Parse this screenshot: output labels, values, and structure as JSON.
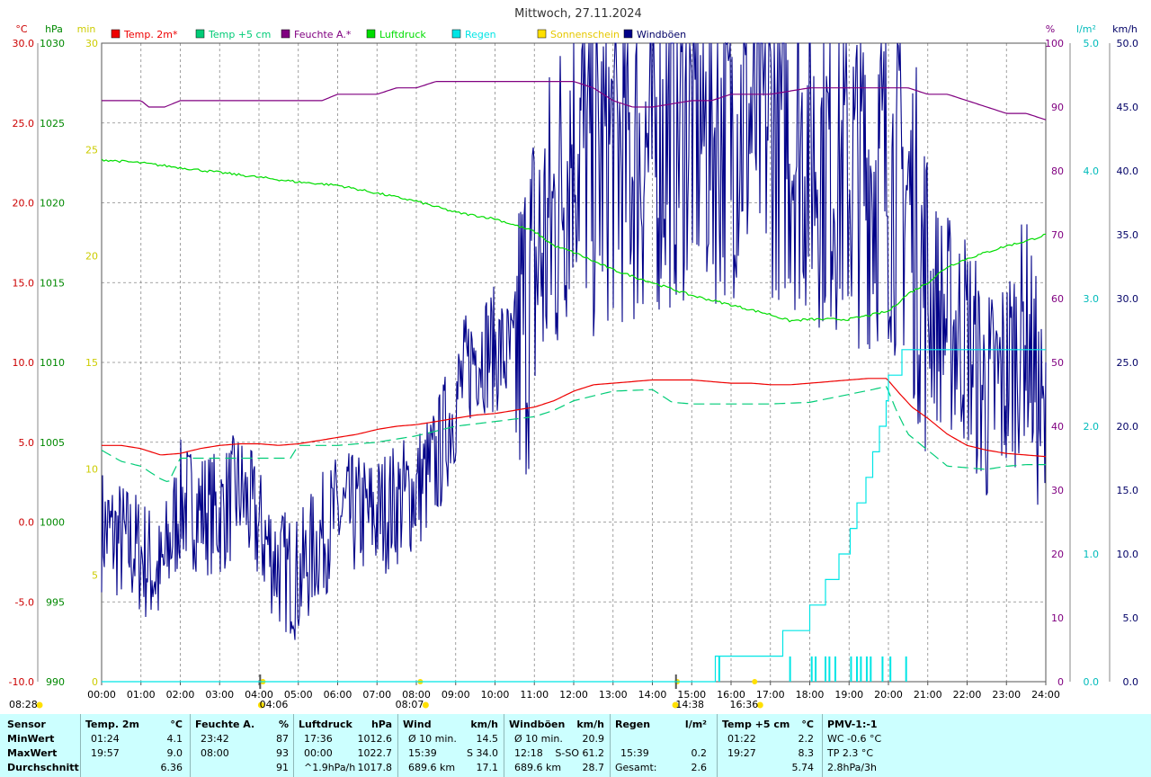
{
  "title": "Mittwoch, 27.11.2024",
  "colors": {
    "temp2m": "#ee0000",
    "temp5cm": "#00cc77",
    "humidity": "#800080",
    "pressure": "#00dd00",
    "rain": "#00e5e5",
    "sun": "#ffe000",
    "wind": "#000088",
    "grid": "#888888",
    "axis_c": "#cc0000",
    "axis_hpa": "#008800",
    "axis_min": "#cccc00",
    "axis_pct": "#800080",
    "axis_rain": "#00bbbb",
    "axis_kmh": "#000066",
    "stats_bg": "#ccffff"
  },
  "legend": [
    {
      "label": "Temp. 2m*",
      "color": "#ee0000"
    },
    {
      "label": "Temp +5 cm",
      "color": "#00cc77"
    },
    {
      "label": "Feuchte A.*",
      "color": "#800080"
    },
    {
      "label": "Luftdruck",
      "color": "#00dd00"
    },
    {
      "label": "Regen",
      "color": "#00e5e5"
    },
    {
      "label": "Sonnenschein",
      "color": "#ffe000"
    },
    {
      "label": "Windböen",
      "color": "#000088"
    }
  ],
  "chart_data": {
    "type": "line",
    "title": "Mittwoch, 27.11.2024",
    "x_unit": "hours",
    "xlim": [
      0,
      24
    ],
    "grid": true,
    "legend_position": "top",
    "x_ticks": [
      "00:00",
      "01:00",
      "02:00",
      "03:00",
      "04:00",
      "05:00",
      "06:00",
      "07:00",
      "08:00",
      "09:00",
      "10:00",
      "11:00",
      "12:00",
      "13:00",
      "14:00",
      "15:00",
      "16:00",
      "17:00",
      "18:00",
      "19:00",
      "20:00",
      "21:00",
      "22:00",
      "23:00",
      "24:00"
    ],
    "x_markers": [
      "04:06",
      "08:07",
      "14:38",
      "16:36"
    ],
    "axes": {
      "celsius": {
        "unit": "°C",
        "range": [
          -10,
          30
        ],
        "ticks": [
          "30.0",
          "25.0",
          "20.0",
          "15.0",
          "10.0",
          "5.0",
          "0.0",
          "-5.0",
          "-10.0"
        ]
      },
      "hpa": {
        "unit": "hPa",
        "range": [
          990,
          1030
        ],
        "ticks": [
          "1030",
          "1025",
          "1020",
          "1015",
          "1010",
          "1005",
          "1000",
          "995",
          "990"
        ]
      },
      "minutes": {
        "unit": "min",
        "range": [
          0,
          30
        ],
        "ticks": [
          "30",
          "25",
          "20",
          "15",
          "10",
          "5",
          "0"
        ]
      },
      "percent": {
        "unit": "%",
        "range": [
          0,
          100
        ],
        "ticks": [
          "100",
          "90",
          "80",
          "70",
          "60",
          "50",
          "40",
          "30",
          "20",
          "10",
          "0"
        ]
      },
      "rain": {
        "unit": "l/m²",
        "range": [
          0,
          5
        ],
        "ticks": [
          "5.0",
          "4.0",
          "3.0",
          "2.0",
          "1.0",
          "0.0"
        ]
      },
      "kmh": {
        "unit": "km/h",
        "range": [
          0,
          50
        ],
        "ticks": [
          "50.0",
          "45.0",
          "40.0",
          "35.0",
          "30.0",
          "25.0",
          "20.0",
          "15.0",
          "10.0",
          "5.0",
          "0.0"
        ]
      }
    },
    "series": [
      {
        "name": "Temp. 2m*",
        "axis": "celsius",
        "x": [
          0,
          0.5,
          1,
          1.5,
          2,
          2.5,
          3,
          3.5,
          4,
          4.5,
          5,
          5.5,
          6,
          6.5,
          7,
          7.5,
          8,
          8.5,
          9,
          9.5,
          10,
          10.5,
          11,
          11.5,
          12,
          12.5,
          13,
          13.5,
          14,
          14.5,
          15,
          15.5,
          16,
          16.5,
          17,
          17.5,
          18,
          18.5,
          19,
          19.5,
          19.95,
          20.3,
          20.6,
          21,
          21.5,
          22,
          22.5,
          23,
          23.5,
          24
        ],
        "y": [
          4.8,
          4.8,
          4.6,
          4.2,
          4.3,
          4.6,
          4.8,
          4.9,
          4.9,
          4.8,
          4.9,
          5.1,
          5.3,
          5.5,
          5.8,
          6.0,
          6.1,
          6.3,
          6.5,
          6.7,
          6.8,
          7.0,
          7.2,
          7.6,
          8.2,
          8.6,
          8.7,
          8.8,
          8.9,
          8.9,
          8.9,
          8.8,
          8.7,
          8.7,
          8.6,
          8.6,
          8.7,
          8.8,
          8.9,
          9.0,
          9.0,
          8.0,
          7.2,
          6.5,
          5.5,
          4.8,
          4.5,
          4.3,
          4.2,
          4.1
        ]
      },
      {
        "name": "Temp +5 cm",
        "axis": "celsius",
        "dashed": true,
        "x": [
          0,
          0.5,
          1,
          1.5,
          1.7,
          2,
          3,
          4,
          4.8,
          5,
          6,
          7,
          8,
          9,
          10,
          11,
          11.5,
          12,
          13,
          14,
          14.5,
          15,
          16,
          17,
          18,
          19,
          19.6,
          19.95,
          20.2,
          20.5,
          21,
          21.5,
          22,
          22.5,
          23,
          23.5,
          24
        ],
        "y": [
          4.5,
          3.8,
          3.5,
          2.7,
          2.5,
          4.0,
          4.0,
          4.0,
          4.0,
          4.8,
          4.8,
          5.0,
          5.4,
          6.0,
          6.3,
          6.6,
          7.0,
          7.6,
          8.2,
          8.3,
          7.5,
          7.4,
          7.4,
          7.4,
          7.5,
          8.0,
          8.3,
          8.5,
          7.0,
          5.5,
          4.5,
          3.5,
          3.4,
          3.3,
          3.5,
          3.6,
          3.6
        ]
      },
      {
        "name": "Feuchte A.*",
        "axis": "percent",
        "x": [
          0,
          1,
          1.2,
          1.6,
          2,
          3,
          4,
          4.5,
          5,
          5.2,
          5.6,
          6,
          7,
          7.5,
          8,
          8.5,
          9,
          10,
          11,
          11.5,
          12,
          12.5,
          13,
          13.5,
          14,
          15,
          15.5,
          16,
          17,
          18,
          19,
          19.5,
          20,
          20.5,
          21,
          21.5,
          22,
          22.5,
          23,
          23.5,
          24
        ],
        "y": [
          91,
          91,
          90,
          90,
          91,
          91,
          91,
          91,
          91,
          91,
          91,
          92,
          92,
          93,
          93,
          94,
          94,
          94,
          94,
          94,
          94,
          93,
          91,
          90,
          90,
          91,
          91,
          92,
          92,
          93,
          93,
          93,
          93,
          93,
          92,
          92,
          91,
          90,
          89,
          89,
          88
        ]
      },
      {
        "name": "Luftdruck",
        "axis": "hpa",
        "x": [
          0,
          1,
          2,
          3,
          4,
          5,
          6,
          7,
          8,
          9,
          10,
          11,
          11.5,
          12,
          13,
          14,
          15,
          16,
          17,
          17.5,
          18,
          19,
          20,
          20.5,
          21,
          21.5,
          22,
          22.5,
          23,
          23.5,
          24
        ],
        "y": [
          1022.7,
          1022.5,
          1022.2,
          1021.9,
          1021.6,
          1021.3,
          1021.1,
          1020.6,
          1020.1,
          1019.4,
          1019.0,
          1018.2,
          1017.3,
          1016.9,
          1015.8,
          1015.0,
          1014.2,
          1013.6,
          1013.0,
          1012.6,
          1012.7,
          1012.7,
          1013.2,
          1014.3,
          1015.0,
          1016.0,
          1016.5,
          1016.9,
          1017.3,
          1017.6,
          1018.0
        ]
      },
      {
        "name": "Regen",
        "axis": "rain",
        "step": true,
        "x": [
          0,
          15.5,
          15.6,
          16.7,
          17.1,
          17.3,
          18.0,
          18.4,
          18.7,
          19.0,
          19.2,
          19.4,
          19.6,
          19.75,
          19.9,
          20.0,
          20.3,
          20.5,
          24
        ],
        "y": [
          0,
          0,
          0.2,
          0.2,
          0.2,
          0.4,
          0.6,
          0.8,
          1.0,
          1.2,
          1.4,
          1.6,
          1.8,
          2.0,
          2.2,
          2.4,
          2.6,
          2.6,
          2.6
        ]
      },
      {
        "name": "Windböen",
        "axis": "kmh",
        "noisy": true,
        "x": [
          0,
          1,
          1.5,
          2,
          3,
          3.5,
          4,
          4.5,
          5,
          5.5,
          6,
          7,
          7.5,
          8,
          8.5,
          9,
          9.5,
          10,
          10.5,
          11,
          11.5,
          12,
          12.5,
          13,
          13.5,
          14,
          14.5,
          15,
          15.5,
          16,
          16.5,
          17,
          17.5,
          18,
          18.5,
          19,
          19.5,
          20,
          20.5,
          21,
          21.5,
          22,
          22.5,
          23,
          23.5,
          24
        ],
        "y": [
          12,
          10,
          8,
          14,
          13,
          15,
          12,
          9,
          8,
          11,
          13,
          13,
          14,
          15,
          17,
          22,
          26,
          26,
          25,
          32,
          36,
          44,
          40,
          42,
          41,
          42,
          43,
          44,
          43,
          44,
          44,
          44,
          43,
          42,
          41,
          40,
          40,
          40,
          38,
          30,
          28,
          27,
          22,
          24,
          28,
          18
        ]
      }
    ],
    "rain_events_x": [
      15.7,
      17.5,
      18.05,
      18.15,
      18.4,
      18.5,
      18.65,
      19.05,
      19.2,
      19.3,
      19.45,
      19.55,
      19.85,
      20.05,
      20.45
    ],
    "sun_markers_x": [
      4.1,
      8.1,
      14.63,
      16.6
    ]
  },
  "stats": {
    "rows": [
      "MinWert",
      "MaxWert",
      "Durchschnitt"
    ],
    "sensor_label": "Sensor",
    "cols": [
      {
        "header": "Temp. 2m",
        "unit": "°C",
        "min_time": "01:24",
        "min_val": "4.1",
        "max_time": "19:57",
        "max_val": "9.0",
        "avg_time": "",
        "avg_val": "6.36"
      },
      {
        "header": "Feuchte A.",
        "unit": "%",
        "min_time": "23:42",
        "min_val": "87",
        "max_time": "08:00",
        "max_val": "93",
        "avg_time": "",
        "avg_val": "91"
      },
      {
        "header": "Luftdruck",
        "unit": "hPa",
        "min_time": "17:36",
        "min_val": "1012.6",
        "max_time": "00:00",
        "max_val": "1022.7",
        "avg_time": "^1.9hPa/h",
        "avg_val": "1017.8"
      },
      {
        "header": "Wind",
        "unit": "km/h",
        "min_time": "Ø 10 min.",
        "min_val": "14.5",
        "max_time": "15:39",
        "max_val": "S 34.0",
        "avg_time": "689.6 km",
        "avg_val": "17.1"
      },
      {
        "header": "Windböen",
        "unit": "km/h",
        "min_time": "Ø 10 min.",
        "min_val": "20.9",
        "max_time": "12:18",
        "max_val": "S-SO 61.2",
        "avg_time": "689.6 km",
        "avg_val": "28.7"
      },
      {
        "header": "Regen",
        "unit": "l/m²",
        "min_time": "",
        "min_val": "",
        "max_time": "15:39",
        "max_val": "0.2",
        "avg_time": "Gesamt:",
        "avg_val": "2.6"
      },
      {
        "header": "Temp +5 cm",
        "unit": "°C",
        "min_time": "01:22",
        "min_val": "2.2",
        "max_time": "19:27",
        "max_val": "8.3",
        "avg_time": "",
        "avg_val": "5.74"
      }
    ],
    "pmv": {
      "header": "PMV-1:-1",
      "line1": "WC -0.6 °C",
      "line2": "TP 2.3 °C",
      "line3": "2.8hPa/3h"
    }
  }
}
